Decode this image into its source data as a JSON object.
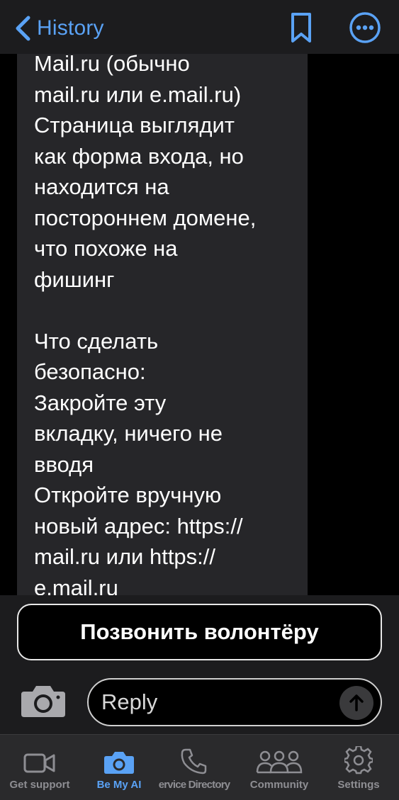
{
  "header": {
    "back_label": "History",
    "back_icon": "chevron-left-icon",
    "bookmark_icon": "bookmark-icon",
    "more_icon": "more-icon",
    "accent_color": "#5aa2f5"
  },
  "message": {
    "text": "Mail.ru (обычно\nmail.ru или e.mail.ru)\nСтраница выглядит\nкак форма входа, но\nнаходится на\nпостороннем домене,\nчто похоже на\nфишинг\n\nЧто сделать\nбезопасно:\nЗакройте эту\nвкладку, ничего не\nвводя\nОткройте вручную\nновый адрес: https://\nmail.ru или https://\ne.mail.ru"
  },
  "composer": {
    "call_button_label": "Позвонить волонтёру",
    "reply_placeholder": "Reply",
    "camera_icon": "camera-icon",
    "send_icon": "arrow-up-icon"
  },
  "tabs": [
    {
      "label": "Get support",
      "icon": "video-icon",
      "active": false
    },
    {
      "label": "Be My AI",
      "icon": "camera-icon",
      "active": true
    },
    {
      "label": "ervice Directory",
      "icon": "phone-icon",
      "active": false
    },
    {
      "label": "Community",
      "icon": "people-icon",
      "active": false
    },
    {
      "label": "Settings",
      "icon": "gear-icon",
      "active": false
    }
  ]
}
